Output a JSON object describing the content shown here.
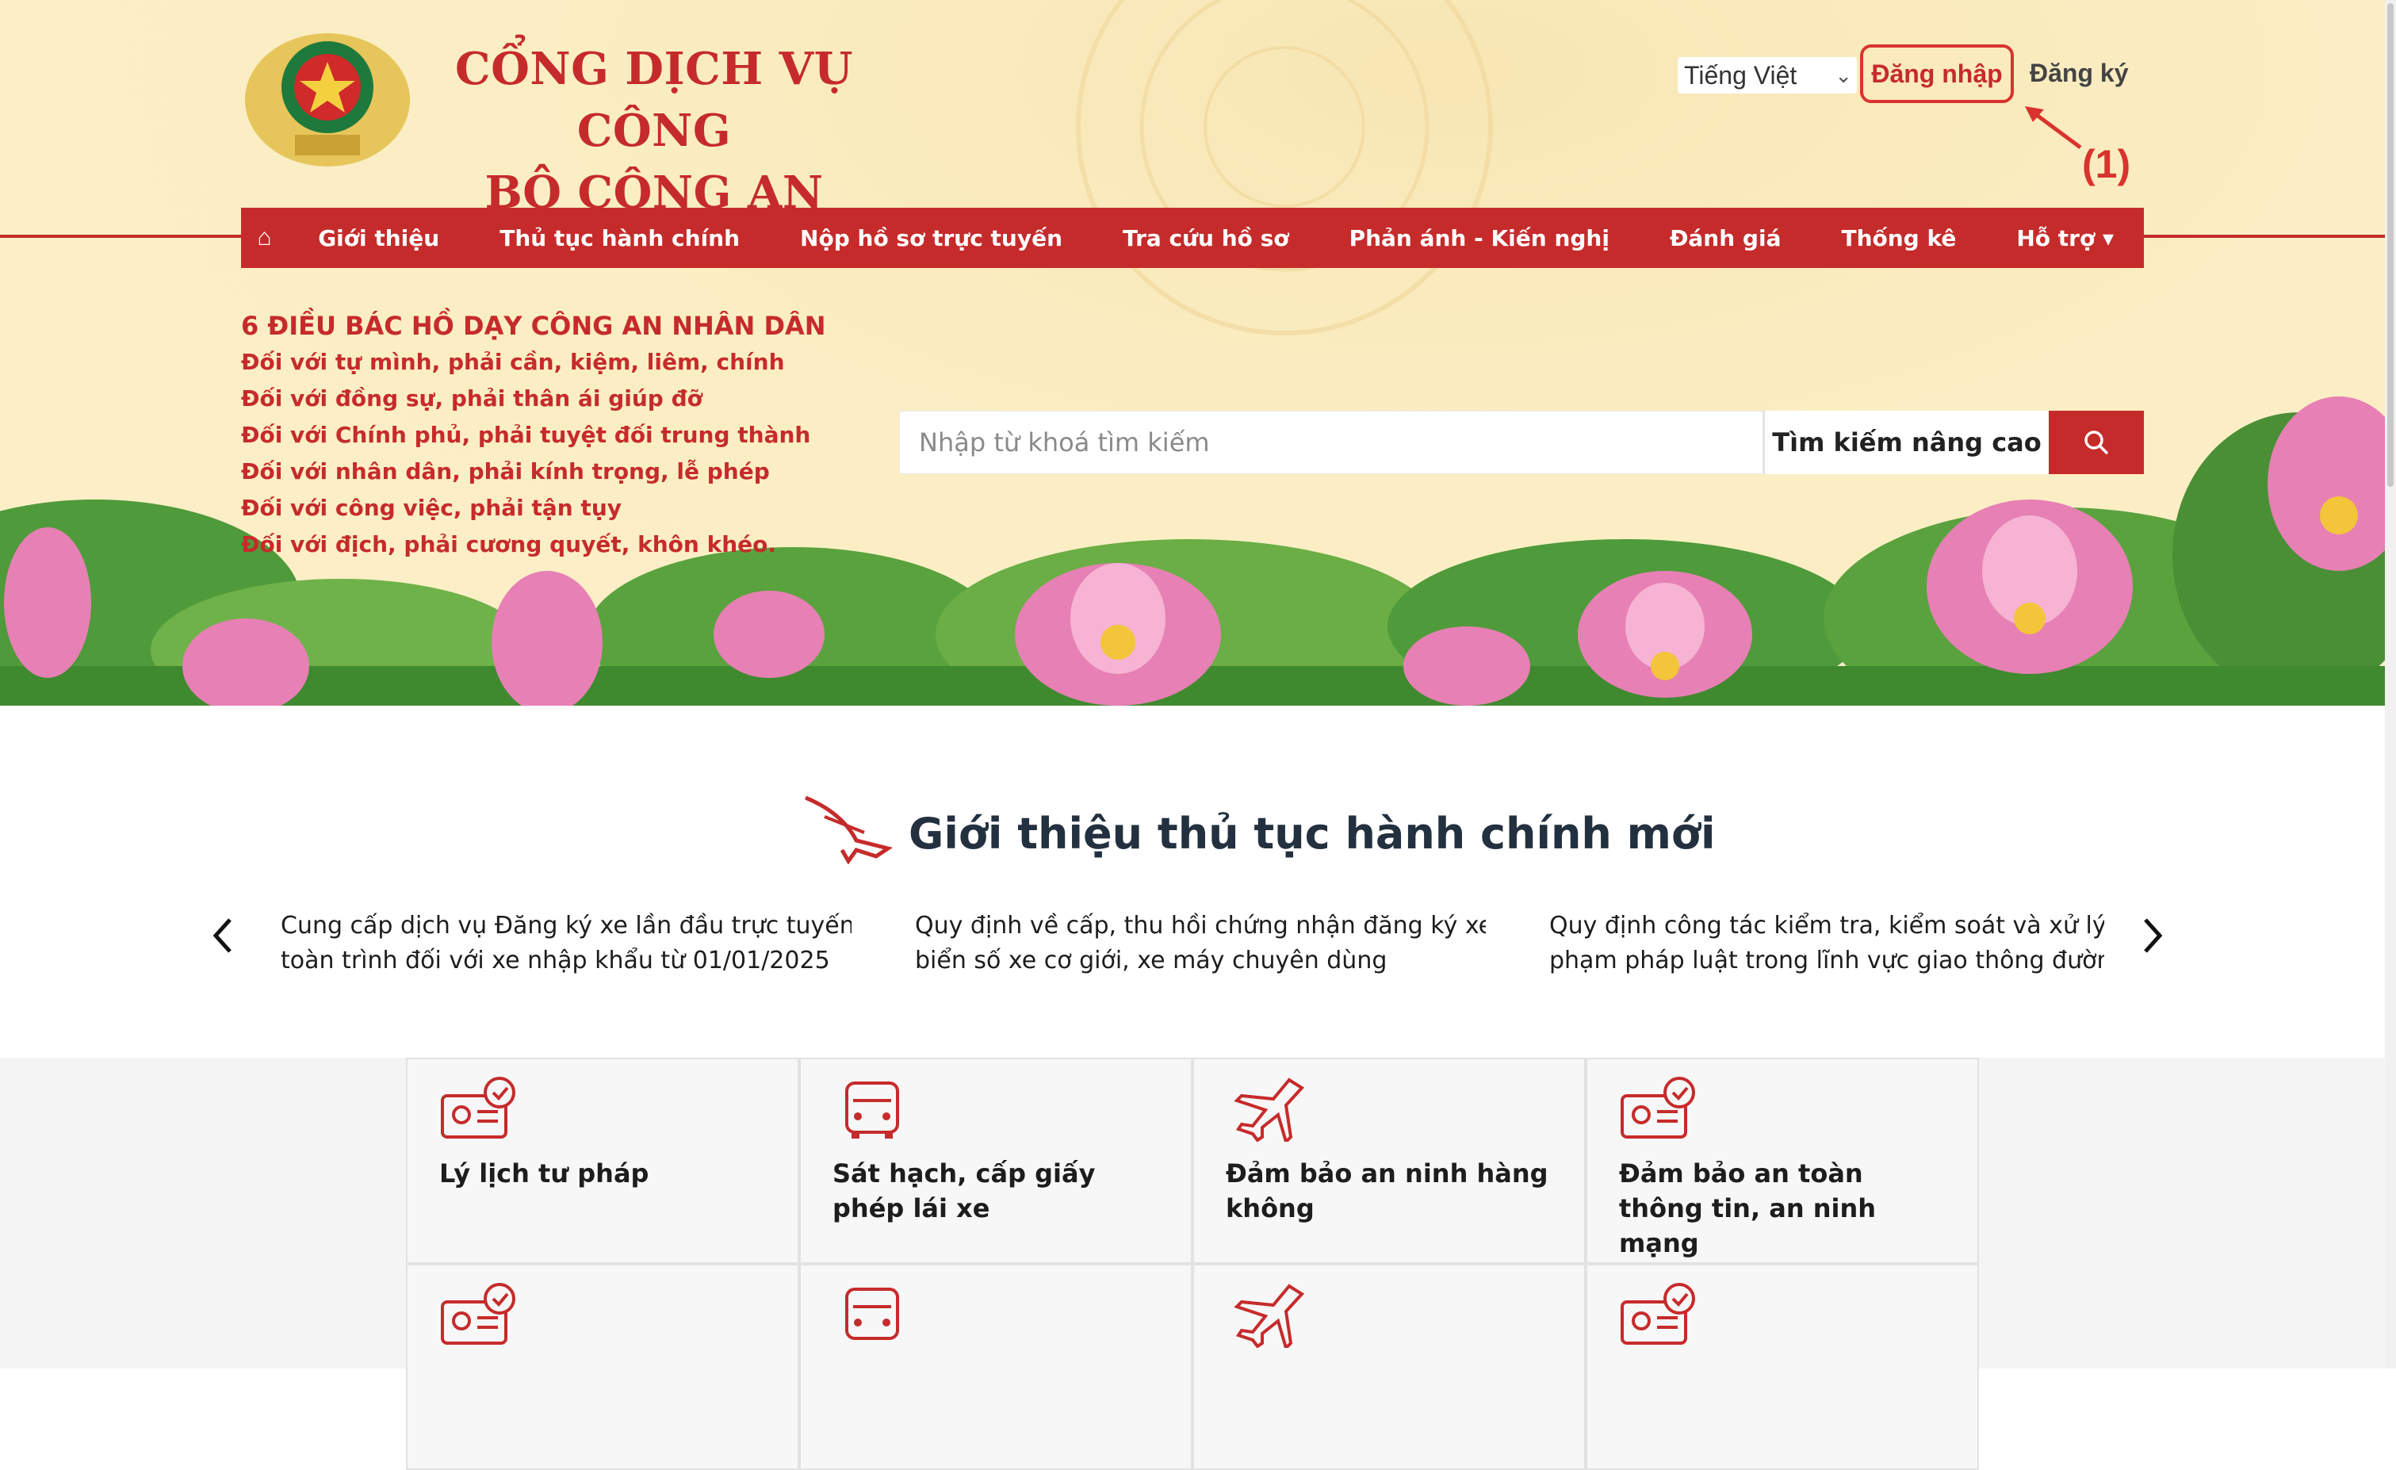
{
  "header": {
    "brand_line1": "CỔNG DỊCH VỤ CÔNG",
    "brand_line2": "BỘ CÔNG AN",
    "language": "Tiếng Việt",
    "login": "Đăng nhập",
    "register": "Đăng ký",
    "annotation": "(1)",
    "accent": "#c62b2b"
  },
  "nav": {
    "home_icon": "home-icon",
    "items": [
      "Giới thiệu",
      "Thủ tục hành chính",
      "Nộp hồ sơ trực tuyến",
      "Tra cứu hồ sơ",
      "Phản ánh - Kiến nghị",
      "Đánh giá",
      "Thống kê",
      "Hỗ trợ"
    ]
  },
  "six": {
    "heading": "6 ĐIỀU BÁC HỒ DẠY CÔNG AN NHÂN DÂN",
    "lines": [
      "Đối với tự mình, phải cần, kiệm, liêm, chính",
      "Đối với đồng sự, phải thân ái giúp đỡ",
      "Đối với Chính phủ, phải tuyệt đối trung thành",
      "Đối với nhân dân, phải kính trọng, lễ phép",
      "Đối với công việc, phải tận tụy",
      "Đối với địch, phải cương quyết, khôn khéo."
    ]
  },
  "search": {
    "placeholder": "Nhập từ khoá tìm kiếm",
    "advanced": "Tìm kiếm nâng cao"
  },
  "intro": {
    "title": "Giới thiệu thủ tục hành chính mới",
    "news": [
      {
        "line1": "Cung cấp dịch vụ Đăng ký xe lần đầu trực tuyến",
        "line2": "toàn trình đối với xe nhập khẩu từ 01/01/2025"
      },
      {
        "line1": "Quy định về cấp, thu hồi chứng nhận đăng ký xe,",
        "line2": "biển số xe cơ giới, xe máy chuyên dùng"
      },
      {
        "line1": "Quy định công tác kiểm tra, kiểm soát và xử lý vi",
        "line2": "phạm pháp luật trong lĩnh vực giao thông đường"
      }
    ]
  },
  "cards": [
    {
      "title": "Lý lịch tư pháp",
      "icon": "id-card-check-icon"
    },
    {
      "title": "Sát hạch, cấp giấy phép lái xe",
      "icon": "car-icon"
    },
    {
      "title": "Đảm bảo an ninh hàng không",
      "icon": "airplane-icon"
    },
    {
      "title": "Đảm bảo an toàn thông tin, an ninh mạng",
      "icon": "id-card-check-icon"
    }
  ]
}
